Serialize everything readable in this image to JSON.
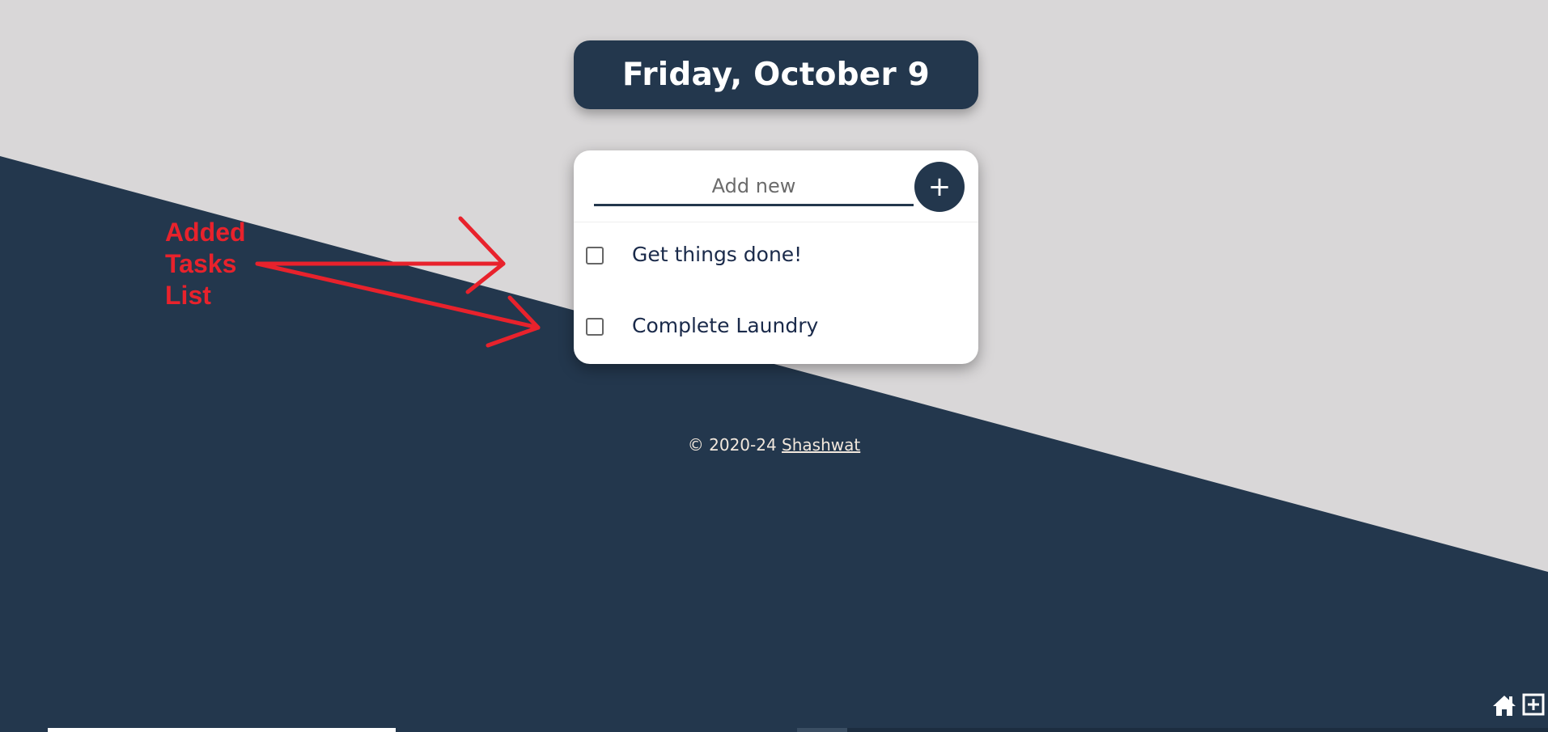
{
  "header": {
    "date": "Friday, October 9"
  },
  "todo": {
    "input_placeholder": "Add new",
    "add_button_label": "+",
    "tasks": [
      {
        "label": "Get things done!",
        "checked": false
      },
      {
        "label": "Complete Laundry",
        "checked": false
      }
    ]
  },
  "footer": {
    "copyright": "© 2020-24 ",
    "author": "Shashwat"
  },
  "annotation": {
    "lines": [
      "Added",
      "Tasks",
      "List"
    ],
    "color": "#e8222c"
  },
  "corner_icons": [
    "home-icon",
    "add-box-icon"
  ],
  "colors": {
    "primary": "#23374d",
    "background": "#d9d7d8"
  }
}
